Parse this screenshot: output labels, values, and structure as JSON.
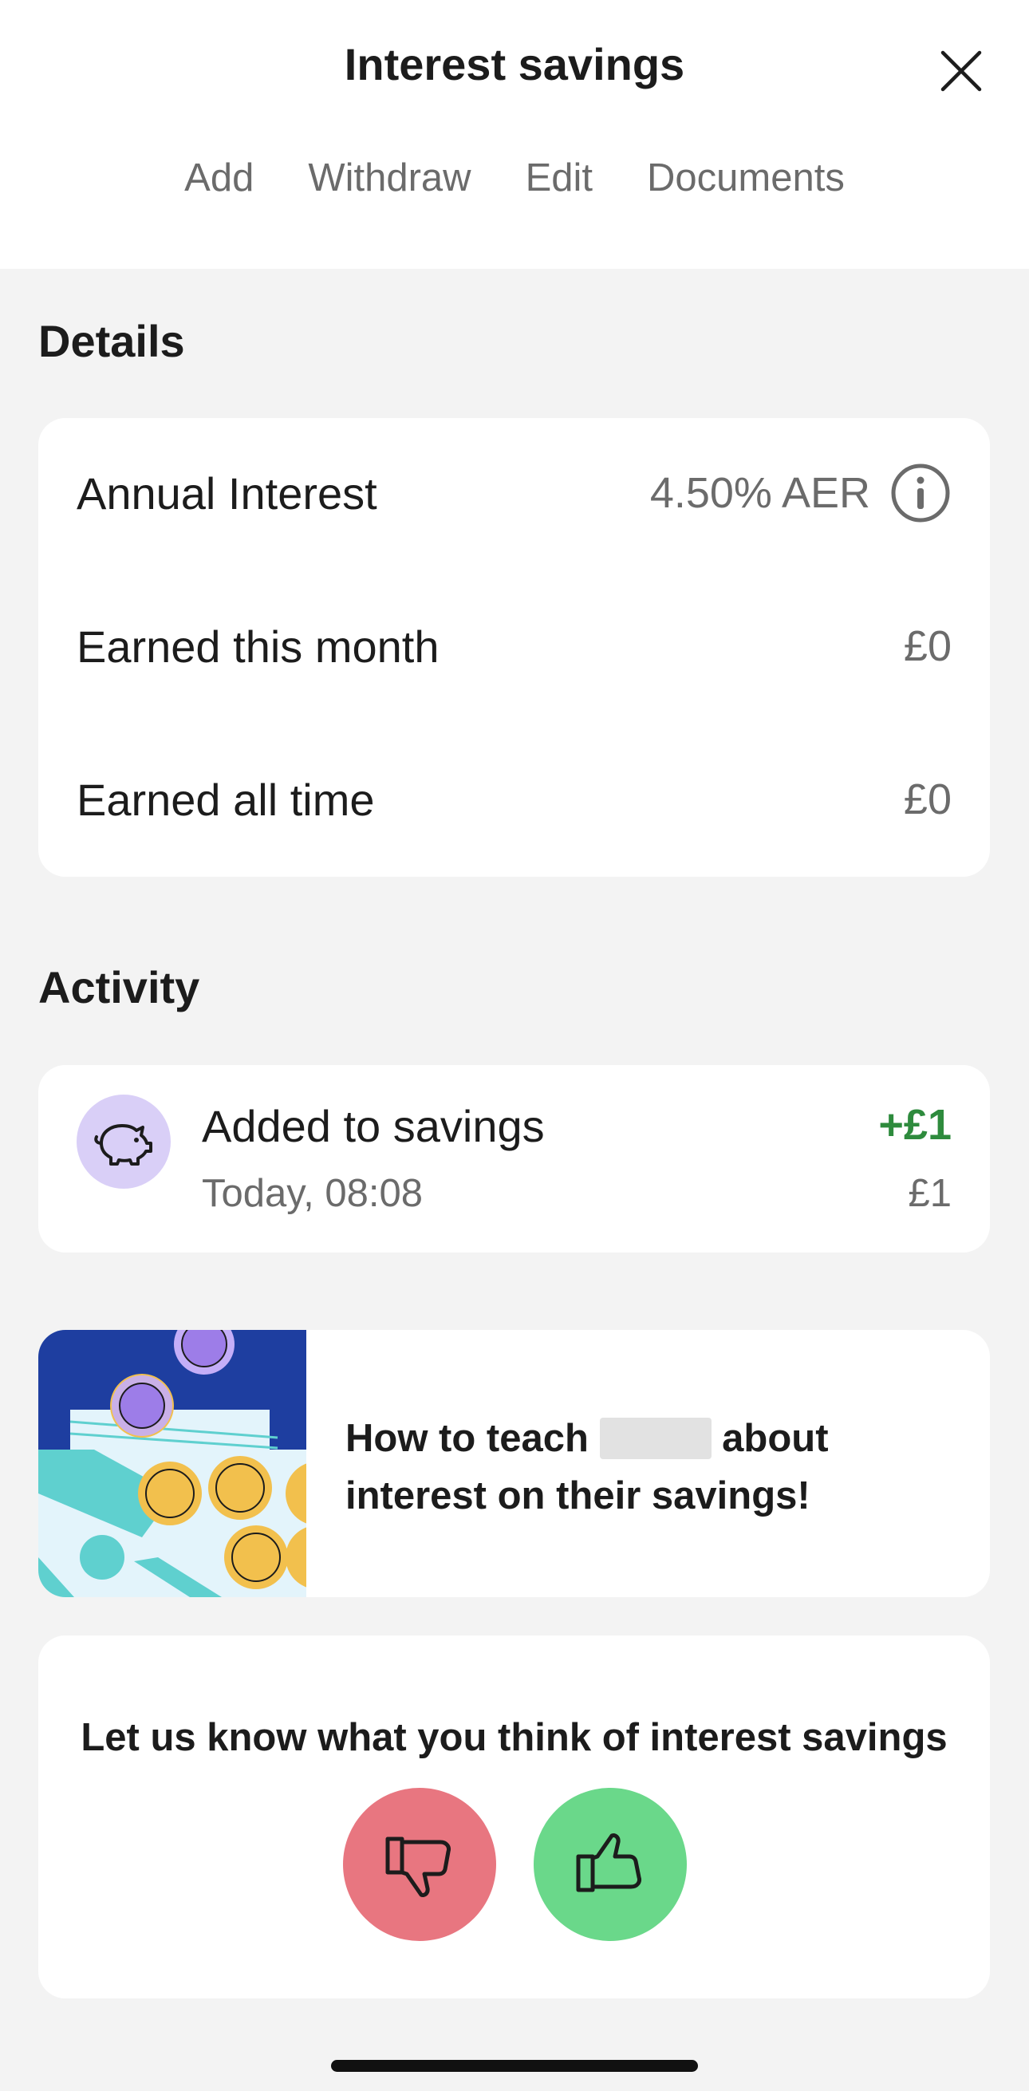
{
  "header": {
    "title": "Interest savings",
    "tabs": [
      "Add",
      "Withdraw",
      "Edit",
      "Documents"
    ]
  },
  "details": {
    "section_title": "Details",
    "rows": [
      {
        "label": "Annual Interest",
        "value": "4.50% AER"
      },
      {
        "label": "Earned this month",
        "value": "£0"
      },
      {
        "label": "Earned all time",
        "value": "£0"
      }
    ]
  },
  "activity": {
    "section_title": "Activity",
    "items": [
      {
        "title": "Added to savings",
        "time": "Today, 08:08",
        "amount": "+£1",
        "balance": "£1",
        "icon": "piggy-bank-icon"
      }
    ]
  },
  "article": {
    "text_before": "How to teach",
    "text_after": "about",
    "text_line2": "interest on their savings!"
  },
  "feedback": {
    "prompt": "Let us know what you think of interest savings",
    "dislike_color": "#e87680",
    "like_color": "#6ad88a"
  },
  "colors": {
    "accent_positive": "#2e8b3d",
    "avatar_bg": "#d9cff7"
  }
}
